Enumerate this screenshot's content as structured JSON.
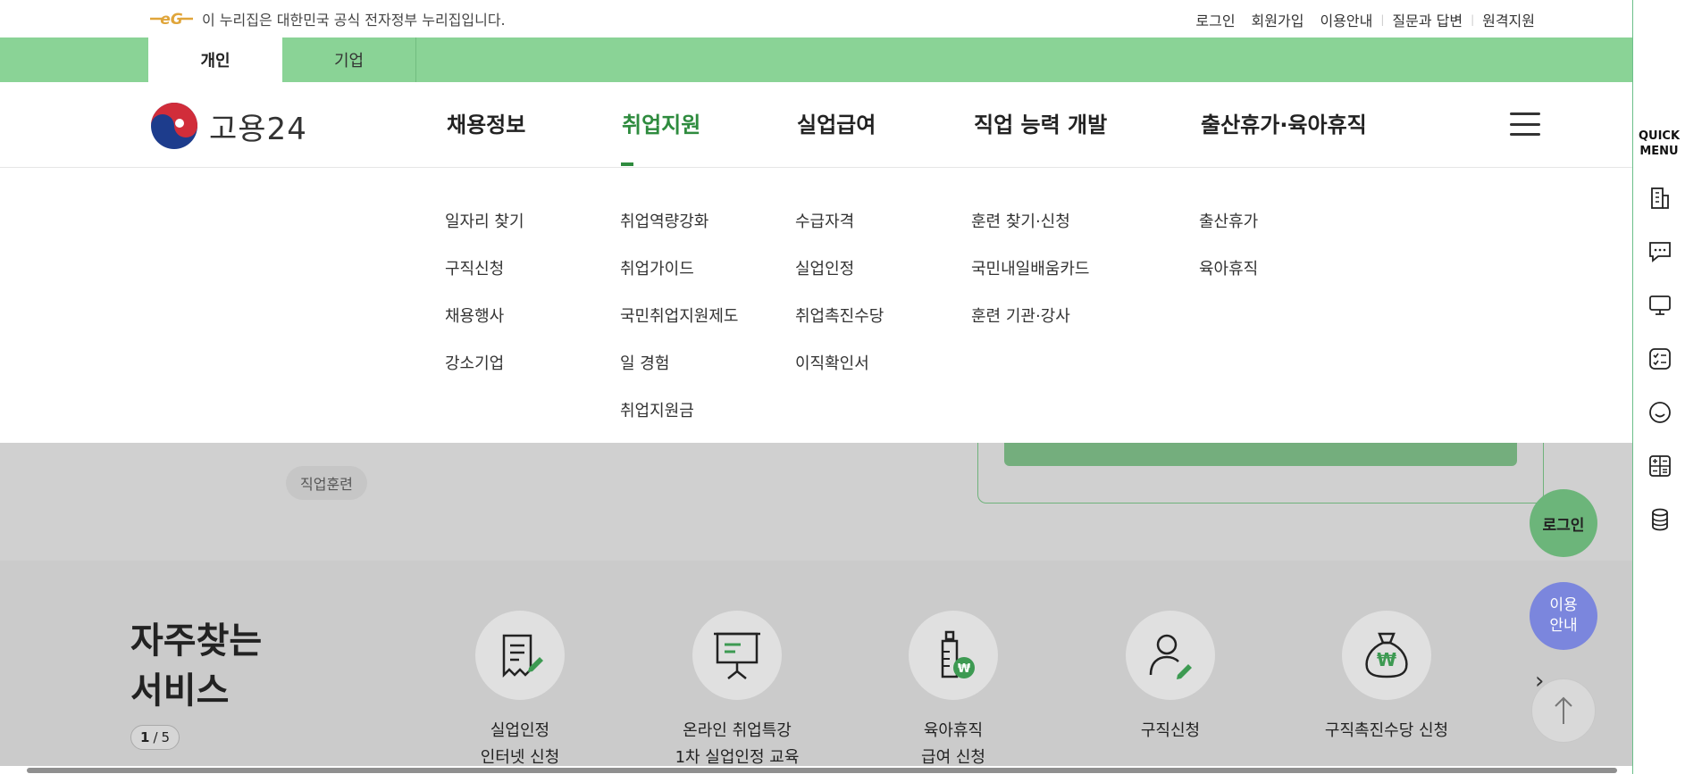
{
  "topbar": {
    "gov_notice": "이 누리집은 대한민국 공식 전자정부 누리집입니다.",
    "gov_logo_text": "eG",
    "links": [
      "로그인",
      "회원가입",
      "이용안내",
      "질문과 답변",
      "원격지원"
    ]
  },
  "tabs": {
    "personal": "개인",
    "business": "기업"
  },
  "logo": {
    "text": "고용24"
  },
  "gnb": {
    "menus": [
      "채용정보",
      "취업지원",
      "실업급여",
      "직업 능력 개발",
      "출산휴가·육아휴직"
    ],
    "active_index": 1
  },
  "mega": {
    "col1": [
      "일자리 찾기",
      "구직신청",
      "채용행사",
      "강소기업"
    ],
    "col2": [
      "취업역량강화",
      "취업가이드",
      "국민취업지원제도",
      "일 경험",
      "취업지원금"
    ],
    "col3": [
      "수급자격",
      "실업인정",
      "취업촉진수당",
      "이직확인서"
    ],
    "col4": [
      "훈련 찾기·신청",
      "국민내일배움카드",
      "훈련 기관·강사"
    ],
    "col5": [
      "출산휴가",
      "육아휴직"
    ]
  },
  "under": {
    "chip": "직업훈련"
  },
  "services": {
    "title_line1": "자주찾는",
    "title_line2": "서비스",
    "pager_current": "1",
    "pager_total": "5",
    "items": [
      "실업인정\n인터넷 신청",
      "온라인 취업특강\n1차 실업인정 교육",
      "육아휴직\n급여 신청",
      "구직신청",
      "구직촉진수당 신청"
    ]
  },
  "fab": {
    "login": "로그인",
    "guide_line1": "이용",
    "guide_line2": "안내"
  },
  "quick_menu": {
    "title_line1": "QUICK",
    "title_line2": "MENU",
    "icons": [
      "building-icon",
      "chat-icon",
      "monitor-icon",
      "checklist-icon",
      "smile-icon",
      "calculator-icon",
      "coins-icon"
    ]
  },
  "colors": {
    "brand_green": "#2e8b3e",
    "tab_green": "#8ad396",
    "guide_blue": "#7b86dd"
  }
}
